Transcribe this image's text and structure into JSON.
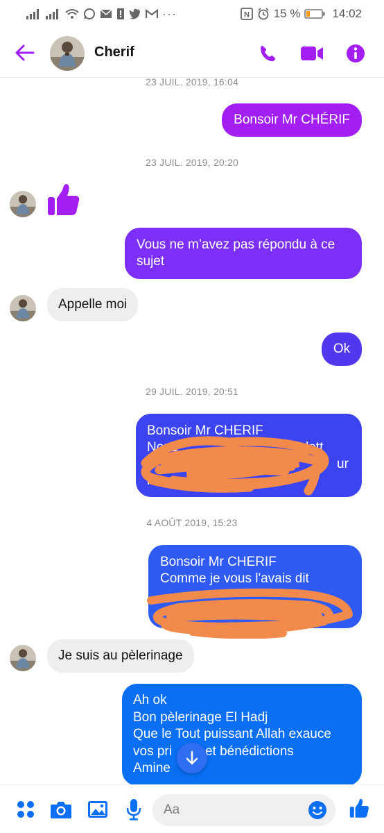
{
  "status_bar": {
    "battery": "15 %",
    "time": "14:02",
    "left_icons": [
      "signal-icon",
      "signal-icon",
      "wifi-icon",
      "whatsapp-icon",
      "mail-icon",
      "sim-icon",
      "twitter-icon",
      "gmail-icon"
    ],
    "more": "···"
  },
  "header": {
    "contact_name": "Cherif",
    "accent_color": "#a31ef3"
  },
  "conversation": {
    "ts1": "23 JUIL. 2019, 16:04",
    "msg1": "Bonsoir Mr CHÉRIF",
    "ts2": "23 JUIL. 2019, 20:20",
    "msg3_line1": "Vous ne m’avez pas répondu à ce",
    "msg3_line2": "sujet",
    "msg4": "Appelle moi",
    "msg5": "Ok",
    "ts3": "29 JUIL. 2019, 20:51",
    "msg6_line1": "Bonsoir Mr CHERIF",
    "msg6_line2": "Nous",
    "msg6_frag_a": "lett",
    "msg6_frag_b": "ur",
    "msg6_frag_c": "r",
    "ts4": "4 AOÛT 2019, 15:23",
    "msg7_line1": "Bonsoir Mr CHERIF",
    "msg7_line2": "Comme je vous l'avais dit",
    "msg8": "Je suis au pèlerinage",
    "msg9_line1": "Ah ok",
    "msg9_line2": "Bon pèlerinage El Hadj",
    "msg9_line3": "Que le Tout puissant Allah exauce",
    "msg9_line4": "vos pri",
    "msg9_line4b": "et bénédictions",
    "msg9_line5": "Amine",
    "colors": {
      "purple": "#a31ef3",
      "violet": "#7b2ff7",
      "indigo": "#5138ef",
      "blue": "#2f5bf4",
      "azure": "#0a6ff5",
      "scribble": "#f28a4b"
    }
  },
  "composer": {
    "placeholder": "Aa",
    "icons": [
      "apps-icon",
      "camera-icon",
      "gallery-icon",
      "microphone-icon",
      "emoji-icon",
      "thumbs-up-icon"
    ]
  }
}
